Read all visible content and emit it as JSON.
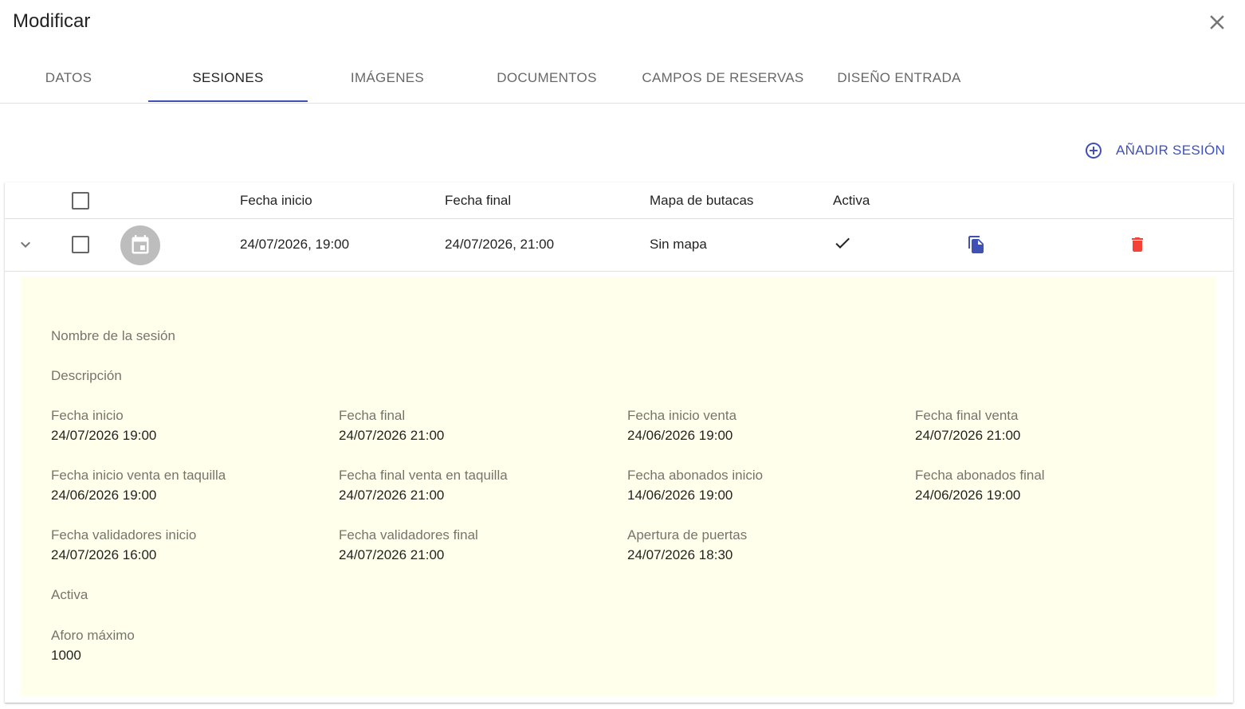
{
  "dialog": {
    "title": "Modificar"
  },
  "tabs": [
    {
      "label": "DATOS",
      "active": false
    },
    {
      "label": "SESIONES",
      "active": true
    },
    {
      "label": "IMÁGENES",
      "active": false
    },
    {
      "label": "DOCUMENTOS",
      "active": false
    },
    {
      "label": "CAMPOS DE RESERVAS",
      "active": false
    },
    {
      "label": "DISEÑO ENTRADA",
      "active": false
    }
  ],
  "actions": {
    "add_session": "AÑADIR SESIÓN"
  },
  "table": {
    "headers": {
      "start": "Fecha inicio",
      "end": "Fecha final",
      "seat_map": "Mapa de butacas",
      "active": "Activa"
    },
    "rows": [
      {
        "start": "24/07/2026, 19:00",
        "end": "24/07/2026, 21:00",
        "seat_map": "Sin mapa",
        "active": true
      }
    ]
  },
  "detail": {
    "name_label": "Nombre de la sesión",
    "description_label": "Descripción",
    "fields": [
      {
        "label": "Fecha inicio",
        "value": "24/07/2026 19:00"
      },
      {
        "label": "Fecha final",
        "value": "24/07/2026 21:00"
      },
      {
        "label": "Fecha inicio venta",
        "value": "24/06/2026 19:00"
      },
      {
        "label": "Fecha final venta",
        "value": "24/07/2026 21:00"
      },
      {
        "label": "Fecha inicio venta en taquilla",
        "value": "24/06/2026 19:00"
      },
      {
        "label": "Fecha final venta en taquilla",
        "value": "24/07/2026 21:00"
      },
      {
        "label": "Fecha abonados inicio",
        "value": "14/06/2026 19:00"
      },
      {
        "label": "Fecha abonados final",
        "value": "24/06/2026 19:00"
      },
      {
        "label": "Fecha validadores inicio",
        "value": "24/07/2026 16:00"
      },
      {
        "label": "Fecha validadores final",
        "value": "24/07/2026 21:00"
      },
      {
        "label": "Apertura de puertas",
        "value": "24/07/2026 18:30"
      }
    ],
    "active_label": "Activa",
    "capacity_label": "Aforo máximo",
    "capacity_value": "1000"
  },
  "colors": {
    "primary": "#3f51b5",
    "delete": "#f44336",
    "detail_background": "#ffffec",
    "avatar": "#bdbdbd"
  },
  "icons": [
    "close-icon",
    "chevron-down-icon",
    "calendar-icon",
    "check-icon",
    "copy-icon",
    "delete-icon",
    "add-circle-icon"
  ]
}
